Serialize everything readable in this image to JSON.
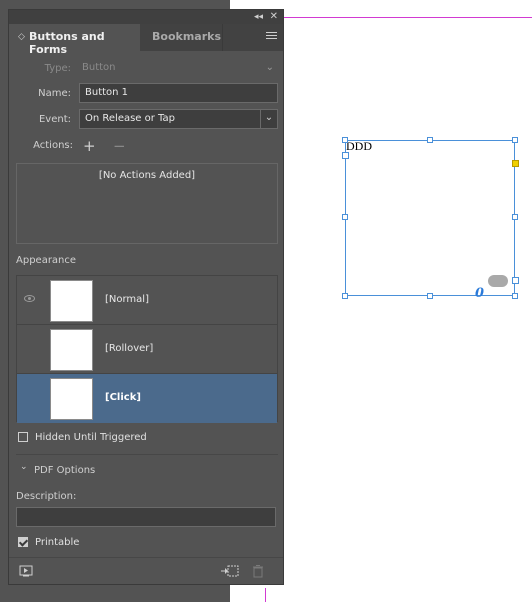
{
  "panel": {
    "tabs": [
      {
        "label": "Buttons and Forms",
        "active": true
      },
      {
        "label": "Bookmarks",
        "active": false
      }
    ],
    "type": {
      "label": "Type:",
      "value": "Button"
    },
    "name": {
      "label": "Name:",
      "value": "Button 1"
    },
    "event": {
      "label": "Event:",
      "value": "On Release or Tap"
    },
    "actions": {
      "label": "Actions:",
      "add": "+",
      "remove": "−",
      "empty_text": "[No Actions Added]"
    },
    "appearance": {
      "title": "Appearance",
      "states": [
        {
          "label": "[Normal]",
          "selected": false,
          "visible_icon": true
        },
        {
          "label": "[Rollover]",
          "selected": false,
          "visible_icon": false
        },
        {
          "label": "[Click]",
          "selected": true,
          "visible_icon": false
        }
      ]
    },
    "hidden_until_triggered": {
      "label": "Hidden Until Triggered",
      "checked": false
    },
    "pdf_options": {
      "label": "PDF Options",
      "expanded": true
    },
    "description": {
      "label": "Description:",
      "value": ""
    },
    "printable": {
      "label": "Printable",
      "checked": true
    },
    "bottom_icons": [
      "preview-spread-icon",
      "convert-to-button-icon",
      "trash-icon"
    ]
  },
  "canvas": {
    "frame_text": "DDD",
    "colors": {
      "selection": "#4a90d9",
      "guide": "#d23ad2",
      "highlight_handle": "#f0d000"
    }
  }
}
